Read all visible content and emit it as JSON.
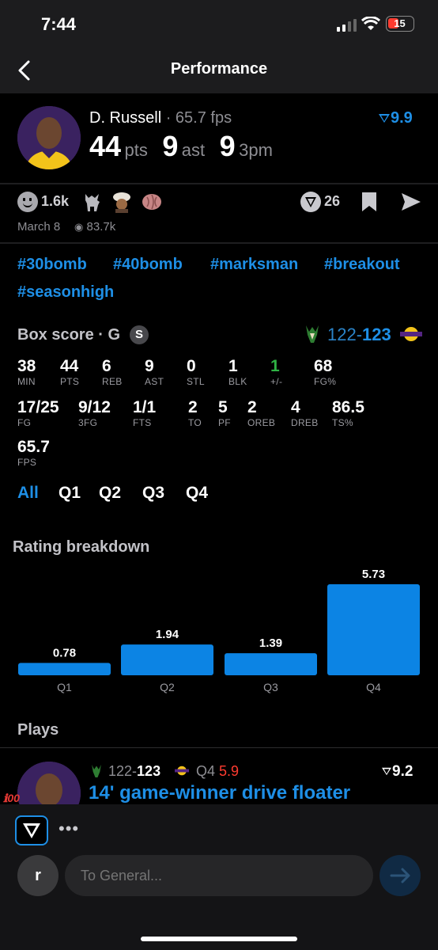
{
  "status": {
    "time": "7:44",
    "battery": "15"
  },
  "nav": {
    "title": "Performance"
  },
  "player": {
    "name": "D. Russell",
    "fps_line": "· 65.7 fps",
    "rating": "9.9",
    "pts": "44",
    "pts_lbl": "pts",
    "ast": "9",
    "ast_lbl": "ast",
    "tpm": "9",
    "tpm_lbl": "3pm"
  },
  "reactions": {
    "count": "1.6k",
    "comments": "26",
    "date": "March 8",
    "views": "83.7k"
  },
  "tags": [
    "#30bomb",
    "#40bomb",
    "#marksman",
    "#breakout",
    "#seasonhigh"
  ],
  "box": {
    "title": "Box score · G",
    "badge": "S",
    "score_a": "122",
    "score_dash": "-",
    "score_b": "123",
    "row1": [
      {
        "v": "38",
        "l": "MIN"
      },
      {
        "v": "44",
        "l": "PTS"
      },
      {
        "v": "6",
        "l": "REB"
      },
      {
        "v": "9",
        "l": "AST"
      },
      {
        "v": "0",
        "l": "STL"
      },
      {
        "v": "1",
        "l": "BLK"
      },
      {
        "v": "1",
        "l": "+/-"
      },
      {
        "v": "68",
        "l": "FG%"
      }
    ],
    "row2": [
      {
        "v": "17/25",
        "l": "FG"
      },
      {
        "v": "9/12",
        "l": "3FG"
      },
      {
        "v": "1/1",
        "l": "FTS"
      },
      {
        "v": "2",
        "l": "TO"
      },
      {
        "v": "5",
        "l": "PF"
      },
      {
        "v": "2",
        "l": "OREB"
      },
      {
        "v": "4",
        "l": "DREB"
      },
      {
        "v": "86.5",
        "l": "TS%"
      }
    ],
    "row3": [
      {
        "v": "65.7",
        "l": "FPS"
      }
    ]
  },
  "quarter_tabs": [
    "All",
    "Q1",
    "Q2",
    "Q3",
    "Q4"
  ],
  "rating_breakdown": {
    "title": "Rating breakdown"
  },
  "chart_data": {
    "type": "bar",
    "categories": [
      "Q1",
      "Q2",
      "Q3",
      "Q4"
    ],
    "values": [
      0.78,
      1.94,
      1.39,
      5.73
    ],
    "title": "Rating breakdown",
    "xlabel": "",
    "ylabel": "",
    "ylim": [
      0,
      5.73
    ]
  },
  "plays": {
    "title": "Plays",
    "score_a": "122",
    "score_b": "123",
    "quarter": "Q4",
    "quarter_rating": "5.9",
    "rating": "9.2",
    "headline": "14' game-winner drive floater"
  },
  "composer": {
    "avatar_letter": "r",
    "placeholder": "To General..."
  },
  "colors": {
    "accent": "#1e8fe6",
    "positive": "#2fb344",
    "negative": "#ff3b30",
    "bar": "#0c84e4"
  }
}
